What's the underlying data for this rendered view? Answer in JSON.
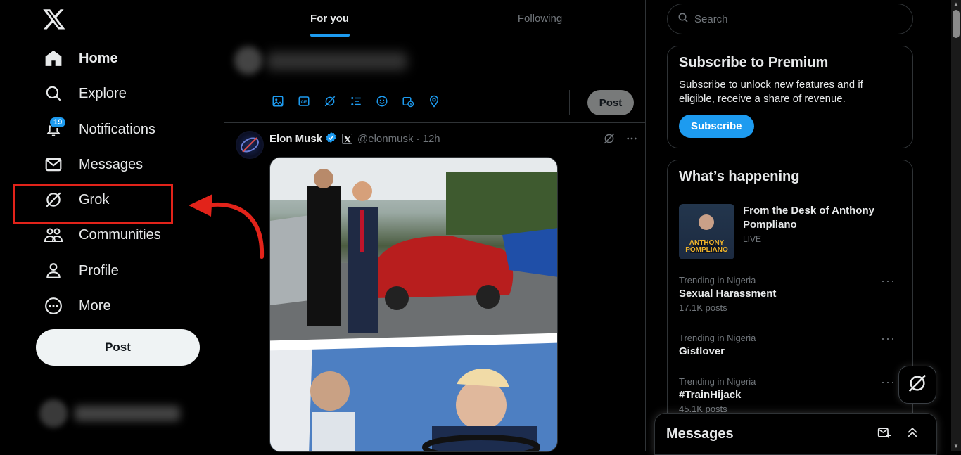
{
  "nav": {
    "items": [
      {
        "label": "Home",
        "icon": "home-icon",
        "active": true
      },
      {
        "label": "Explore",
        "icon": "search-icon"
      },
      {
        "label": "Notifications",
        "icon": "bell-icon",
        "badge": "19"
      },
      {
        "label": "Messages",
        "icon": "envelope-icon"
      },
      {
        "label": "Grok",
        "icon": "grok-icon"
      },
      {
        "label": "Communities",
        "icon": "people-icon"
      },
      {
        "label": "Profile",
        "icon": "person-icon"
      },
      {
        "label": "More",
        "icon": "more-circle-icon"
      }
    ],
    "post_label": "Post"
  },
  "feed": {
    "tabs": [
      "For you",
      "Following"
    ],
    "composer_post_label": "Post",
    "tweet": {
      "name": "Elon Musk",
      "handle": "@elonmusk",
      "time": "· 12h"
    }
  },
  "right": {
    "search_placeholder": "Search",
    "premium": {
      "title": "Subscribe to Premium",
      "body": "Subscribe to unlock new features and if eligible, receive a share of revenue.",
      "button": "Subscribe"
    },
    "happening": {
      "title": "What’s happening",
      "live_title": "From the Desk of Anthony Pompliano",
      "live_sub": "LIVE",
      "live_thumb_text": "ANTHONY POMPLIANO",
      "trends": [
        {
          "category": "Trending in Nigeria",
          "name": "Sexual Harassment",
          "count": "17.1K posts"
        },
        {
          "category": "Trending in Nigeria",
          "name": "Gistlover",
          "count": ""
        },
        {
          "category": "Trending in Nigeria",
          "name": "#TrainHijack",
          "count": "45.1K posts"
        }
      ]
    },
    "messages_drawer_title": "Messages"
  },
  "colors": {
    "accent": "#1d9bf0",
    "highlight": "#e2231a",
    "background": "#000000"
  }
}
